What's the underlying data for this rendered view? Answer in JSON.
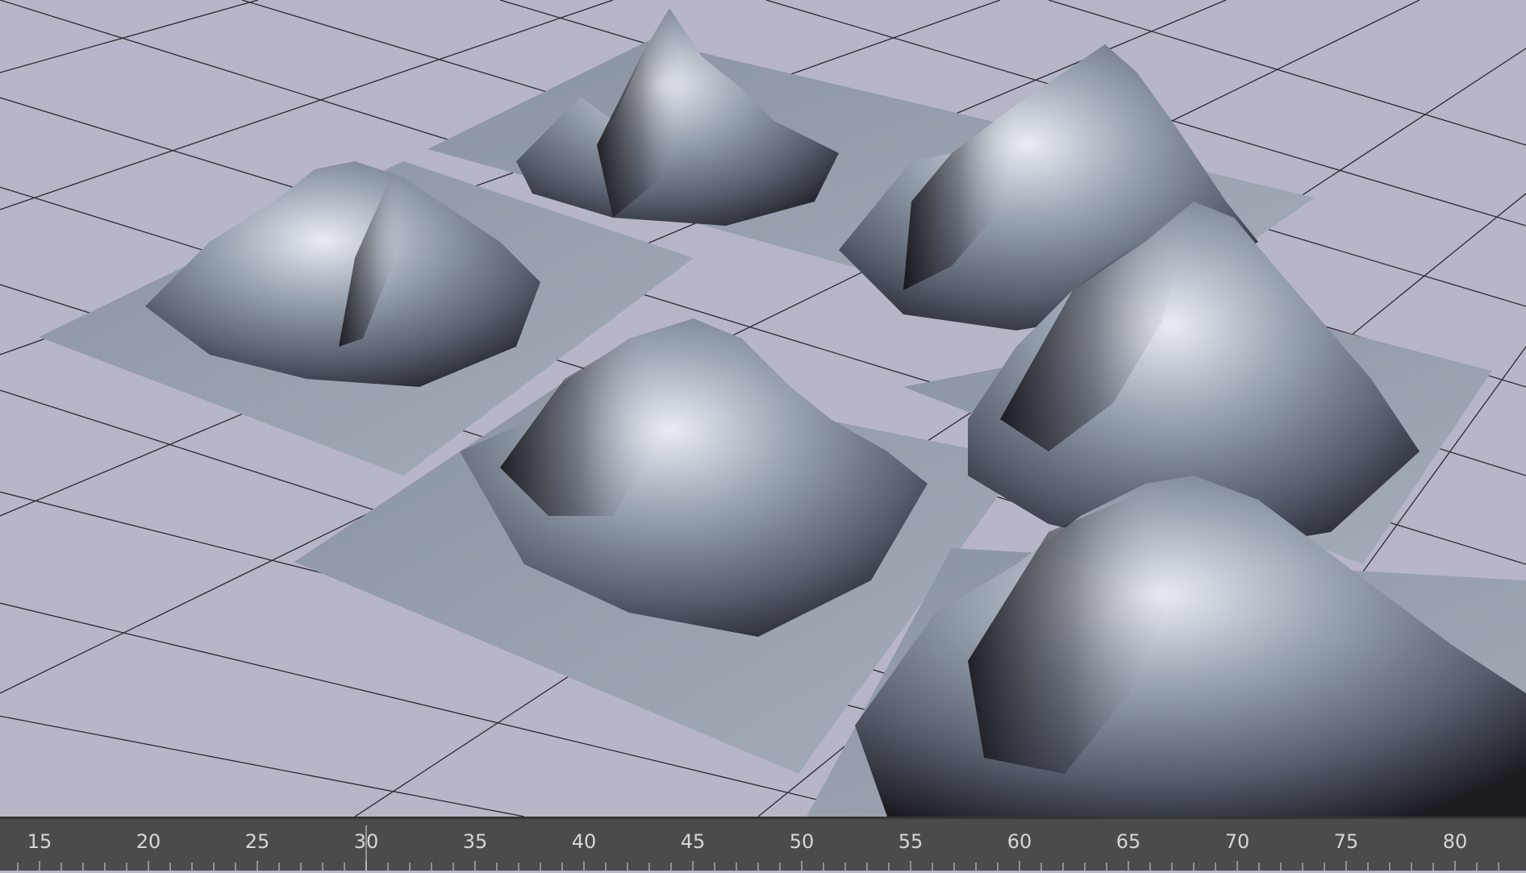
{
  "viewport": {
    "background_color": "#b7b6c6",
    "grid_color": "#2a2a30",
    "terrain_color": "#8e96a3",
    "terrain_count": 5
  },
  "timeline": {
    "background_color": "#4b4b4b",
    "label_color": "#d6d6d6",
    "frame_labels": [
      "15",
      "20",
      "25",
      "30",
      "35",
      "40",
      "45",
      "50",
      "55",
      "60",
      "65",
      "70",
      "75",
      "80"
    ],
    "current_frame": 30
  }
}
